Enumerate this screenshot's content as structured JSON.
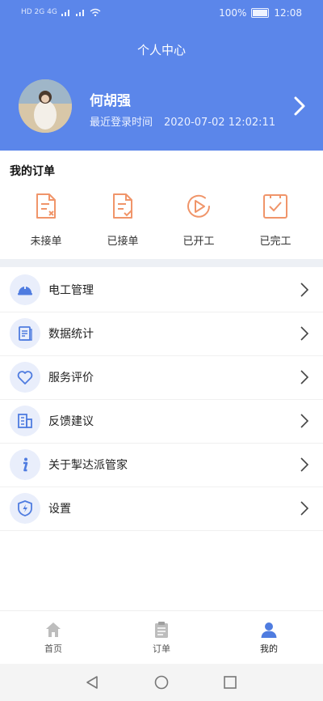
{
  "status_bar": {
    "left": "HD 2G 4G",
    "battery": "100%",
    "time": "12:08"
  },
  "header": {
    "title": "个人中心"
  },
  "profile": {
    "name": "何胡强",
    "login_label": "最近登录时间",
    "login_time": "2020-07-02 12:02:11"
  },
  "orders": {
    "title": "我的订单",
    "items": [
      {
        "label": "未接单",
        "icon": "order-unaccepted-icon"
      },
      {
        "label": "已接单",
        "icon": "order-accepted-icon"
      },
      {
        "label": "已开工",
        "icon": "order-started-icon"
      },
      {
        "label": "已完工",
        "icon": "order-completed-icon"
      }
    ]
  },
  "menu": [
    {
      "label": "电工管理",
      "icon": "helmet-icon"
    },
    {
      "label": "数据统计",
      "icon": "document-stats-icon"
    },
    {
      "label": "服务评价",
      "icon": "heart-icon"
    },
    {
      "label": "反馈建议",
      "icon": "building-icon"
    },
    {
      "label": "关于掣达派管家",
      "icon": "info-icon"
    },
    {
      "label": "设置",
      "icon": "shield-bolt-icon"
    }
  ],
  "bottom_nav": [
    {
      "label": "首页",
      "icon": "home-icon",
      "active": false
    },
    {
      "label": "订单",
      "icon": "clipboard-icon",
      "active": false
    },
    {
      "label": "我的",
      "icon": "user-icon",
      "active": true
    }
  ],
  "colors": {
    "primary": "#5b86ea",
    "orange": "#f0956a",
    "menu_icon_bg": "#e9eefb",
    "icon_blue": "#4f7ce0"
  }
}
